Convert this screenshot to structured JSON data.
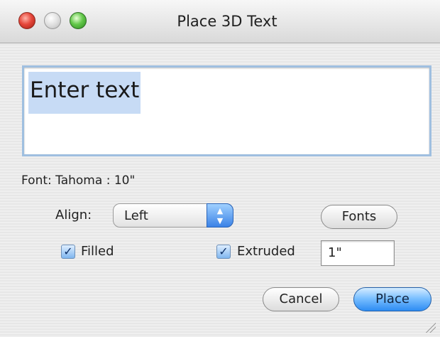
{
  "window": {
    "title": "Place 3D Text"
  },
  "text_input": {
    "value": "Enter text"
  },
  "font_info": "Font: Tahoma : 10\"",
  "align": {
    "label": "Align:",
    "value": "Left"
  },
  "buttons": {
    "fonts": "Fonts",
    "cancel": "Cancel",
    "place": "Place"
  },
  "checkboxes": {
    "filled": {
      "label": "Filled",
      "checked": true
    },
    "extruded": {
      "label": "Extruded",
      "checked": true
    }
  },
  "extrude_depth": {
    "value": "1\""
  },
  "icons": {
    "check": "✓",
    "popup_arrows": "updown-arrows"
  },
  "colors": {
    "accent": "#2d8cf3",
    "selection": "#c7dbf5"
  }
}
